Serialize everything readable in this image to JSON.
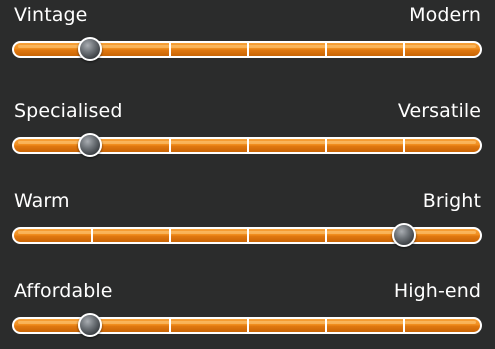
{
  "sliders": [
    {
      "left_label": "Vintage",
      "right_label": "Modern",
      "value": 0.167
    },
    {
      "left_label": "Specialised",
      "right_label": "Versatile",
      "value": 0.167
    },
    {
      "left_label": "Warm",
      "right_label": "Bright",
      "value": 0.833
    },
    {
      "left_label": "Affordable",
      "right_label": "High-end",
      "value": 0.167
    }
  ],
  "colors": {
    "background": "#2b2c2c",
    "track": "#f08c1c",
    "track_border": "#ffffff",
    "thumb": "#5f6368",
    "text": "#ffffff"
  },
  "scale_steps": 6
}
